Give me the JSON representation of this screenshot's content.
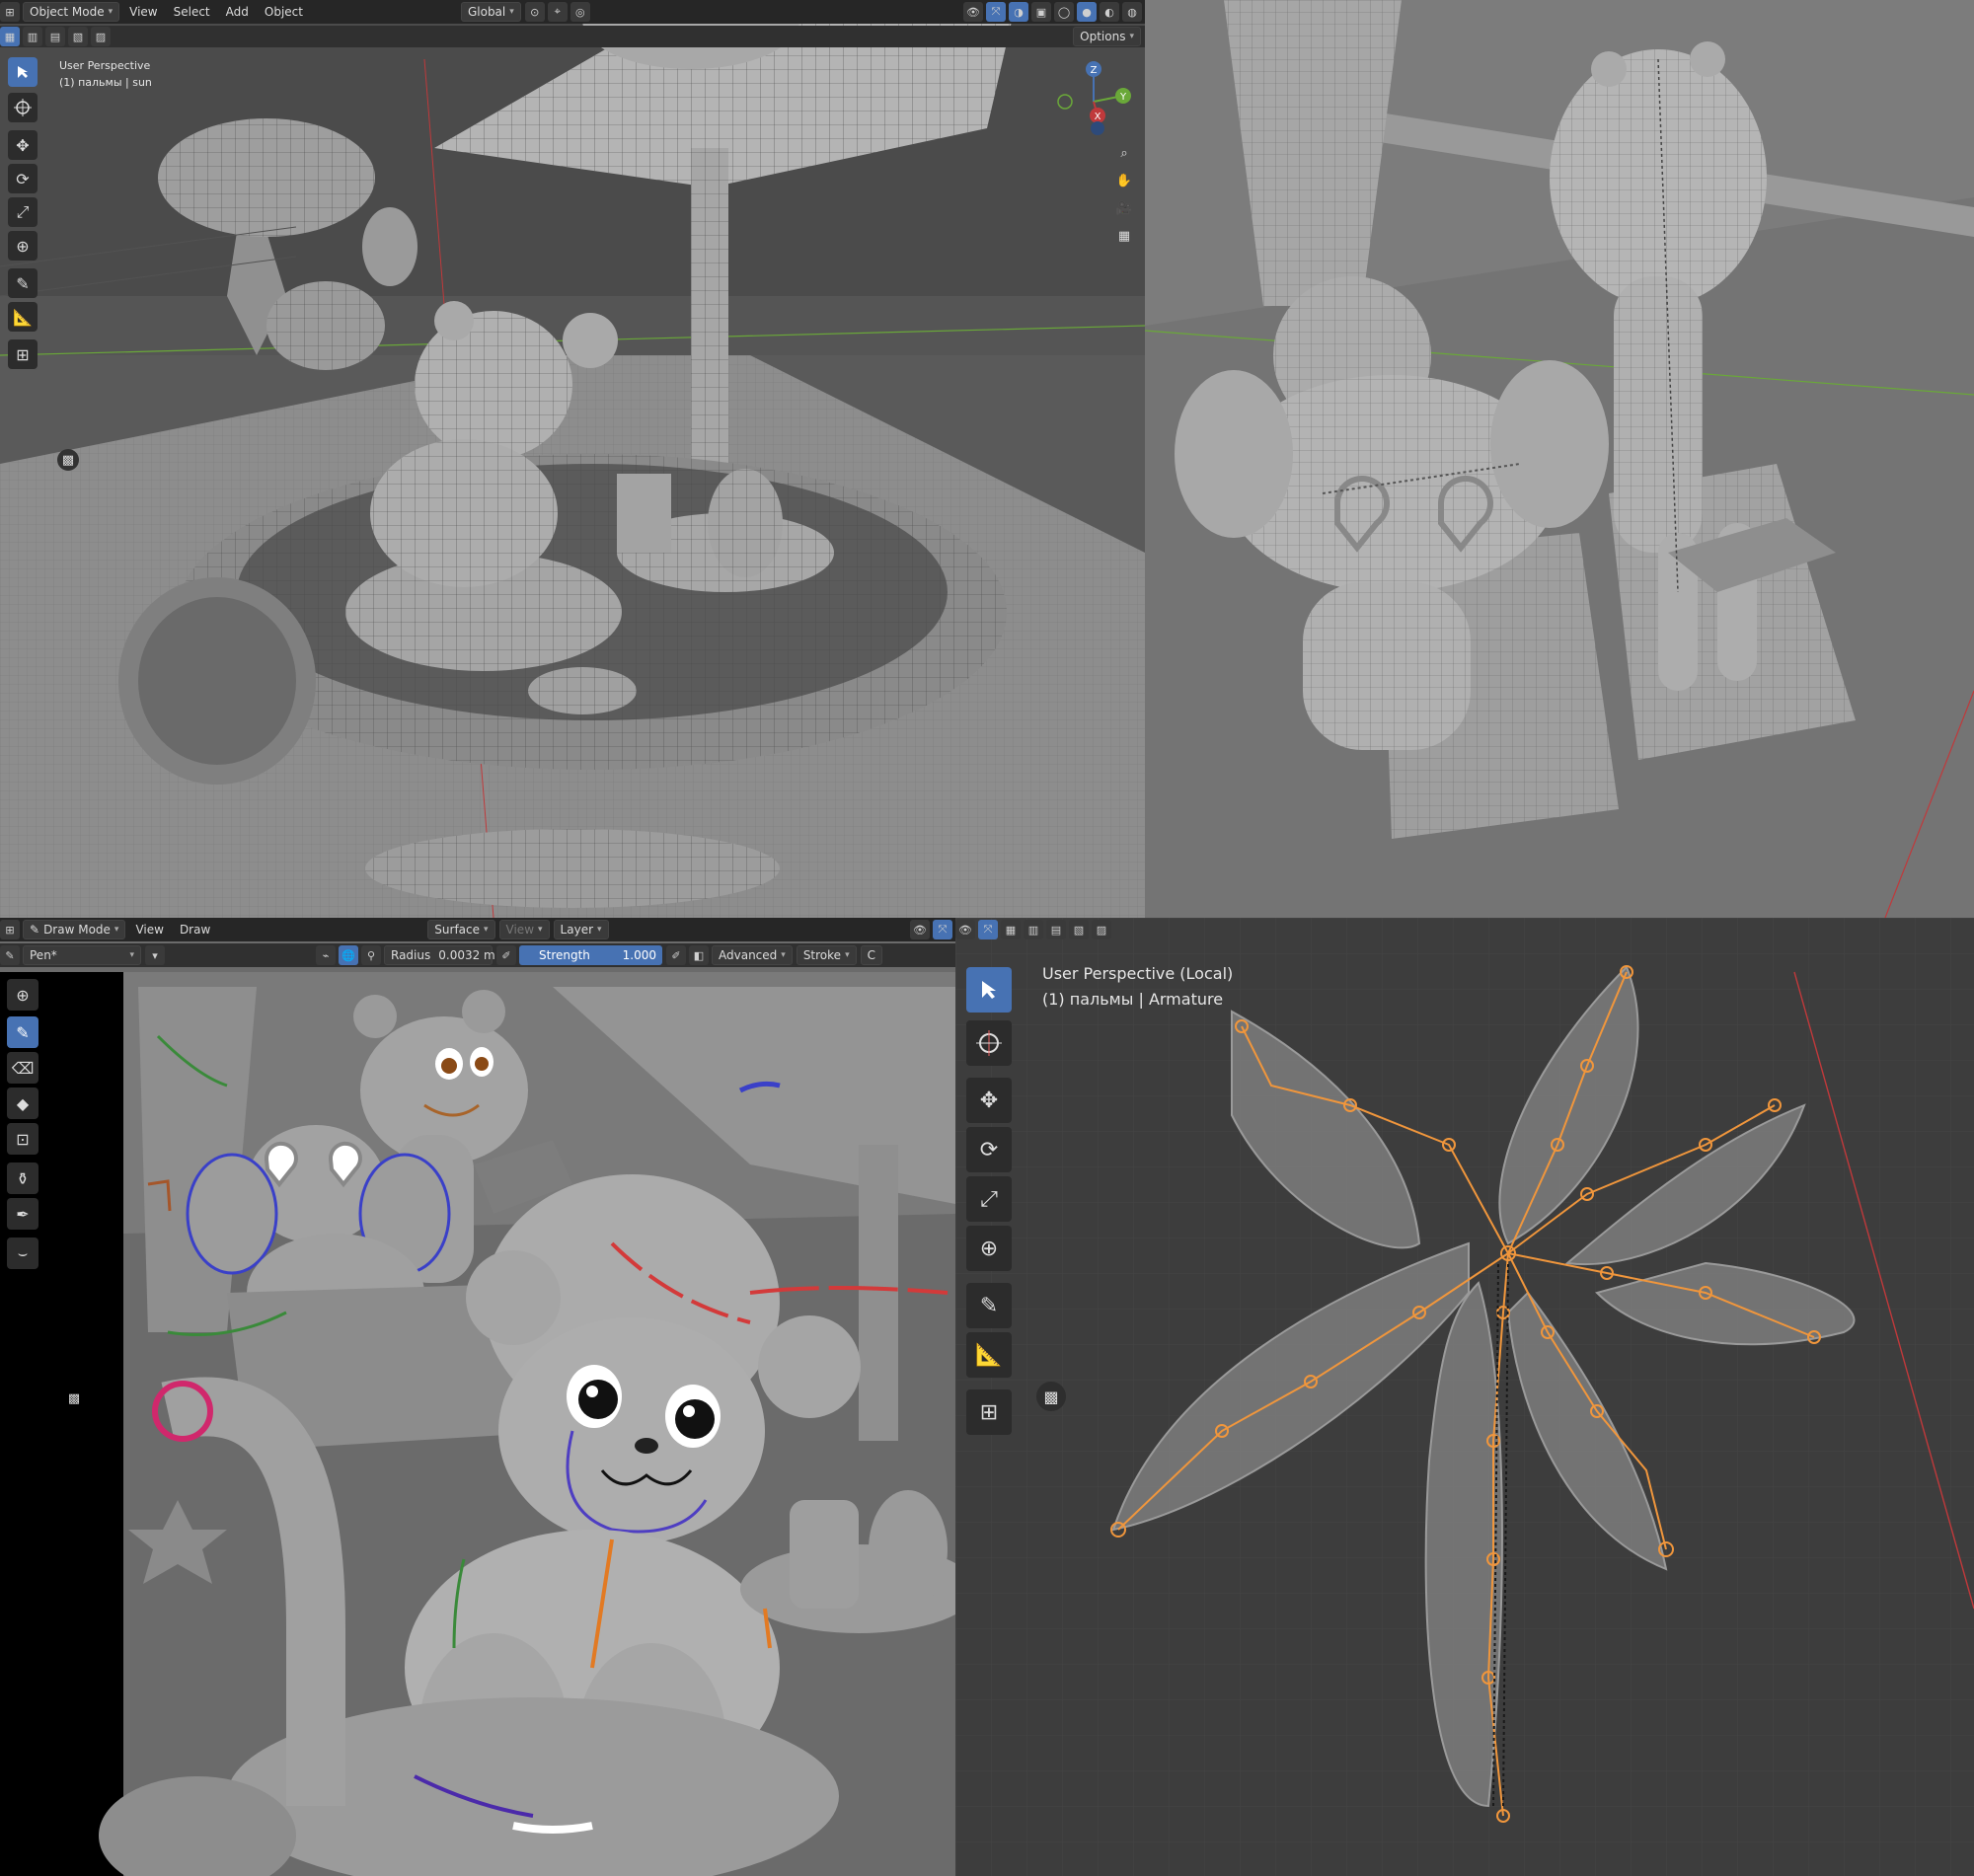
{
  "viewport_object_mode": {
    "header": {
      "mode_label": "Object Mode",
      "menus": [
        "View",
        "Select",
        "Add",
        "Object"
      ],
      "orientation_label": "Global",
      "options_label": "Options"
    },
    "overlay": {
      "perspective": "User Perspective",
      "context": "(1) пальмы | sun"
    },
    "gizmo": {
      "z": "Z",
      "y": "Y",
      "x": "X"
    }
  },
  "viewport_draw_mode": {
    "header": {
      "mode_label": "Draw Mode",
      "menus": [
        "View",
        "Draw"
      ],
      "placement_label": "Surface",
      "view_label": "View",
      "layer_label": "Layer"
    },
    "tool_settings": {
      "brush_name": "Pen*",
      "radius_label": "Radius",
      "radius_value": "0.0032 m",
      "strength_label": "Strength",
      "strength_value": "1.000",
      "strength_fraction": 1.0,
      "advanced_label": "Advanced",
      "stroke_label": "Stroke",
      "cut_label": "C"
    }
  },
  "viewport_armature": {
    "overlay": {
      "perspective": "User Perspective (Local)",
      "context": "(1) пальмы | Armature"
    }
  },
  "colors": {
    "accent_blue": "#4772b3",
    "bone_orange": "#f0963c",
    "axis_red": "#c0393b",
    "axis_green": "#6aa839"
  }
}
